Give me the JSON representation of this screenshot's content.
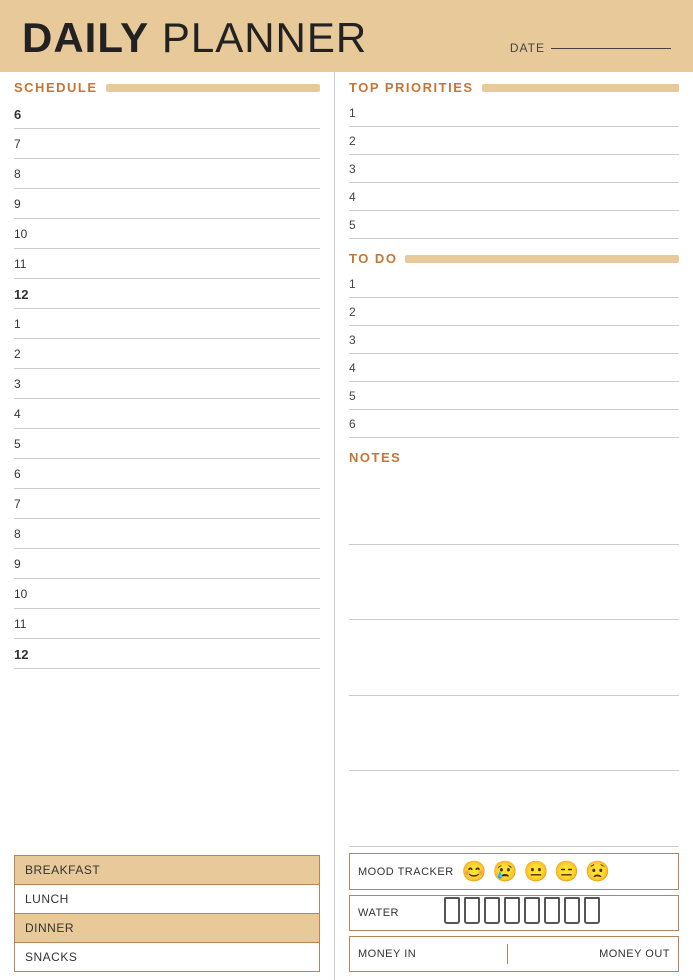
{
  "header": {
    "title_bold": "DAILY",
    "title_light": " PLANNER",
    "date_label": "DATE"
  },
  "schedule": {
    "label": "SCHEDULE",
    "hours": [
      {
        "time": "6",
        "bold": true
      },
      {
        "time": "7",
        "bold": false
      },
      {
        "time": "8",
        "bold": false
      },
      {
        "time": "9",
        "bold": false
      },
      {
        "time": "10",
        "bold": false
      },
      {
        "time": "11",
        "bold": false
      },
      {
        "time": "12",
        "bold": true
      },
      {
        "time": "1",
        "bold": false
      },
      {
        "time": "2",
        "bold": false
      },
      {
        "time": "3",
        "bold": false
      },
      {
        "time": "4",
        "bold": false
      },
      {
        "time": "5",
        "bold": false
      },
      {
        "time": "6",
        "bold": false
      },
      {
        "time": "7",
        "bold": false
      },
      {
        "time": "8",
        "bold": false
      },
      {
        "time": "9",
        "bold": false
      },
      {
        "time": "10",
        "bold": false
      },
      {
        "time": "11",
        "bold": false
      },
      {
        "time": "12",
        "bold": true
      }
    ]
  },
  "meals": {
    "items": [
      "BREAKFAST",
      "LUNCH",
      "DINNER",
      "SNACKS"
    ],
    "shaded": [
      0,
      2
    ]
  },
  "top_priorities": {
    "label": "TOP PRIORITIES",
    "items": [
      "1",
      "2",
      "3",
      "4",
      "5"
    ]
  },
  "todo": {
    "label": "TO DO",
    "items": [
      "1",
      "2",
      "3",
      "4",
      "5",
      "6"
    ]
  },
  "notes": {
    "label": "NOTES",
    "lines": 5
  },
  "mood_tracker": {
    "label": "MOOD TRACKER",
    "faces": [
      "😊",
      "😢",
      "😐",
      "😑",
      "😟"
    ]
  },
  "water": {
    "label": "WATER",
    "cups": 8
  },
  "money": {
    "money_in": "MONEY IN",
    "money_out": "MONEY OUT"
  }
}
